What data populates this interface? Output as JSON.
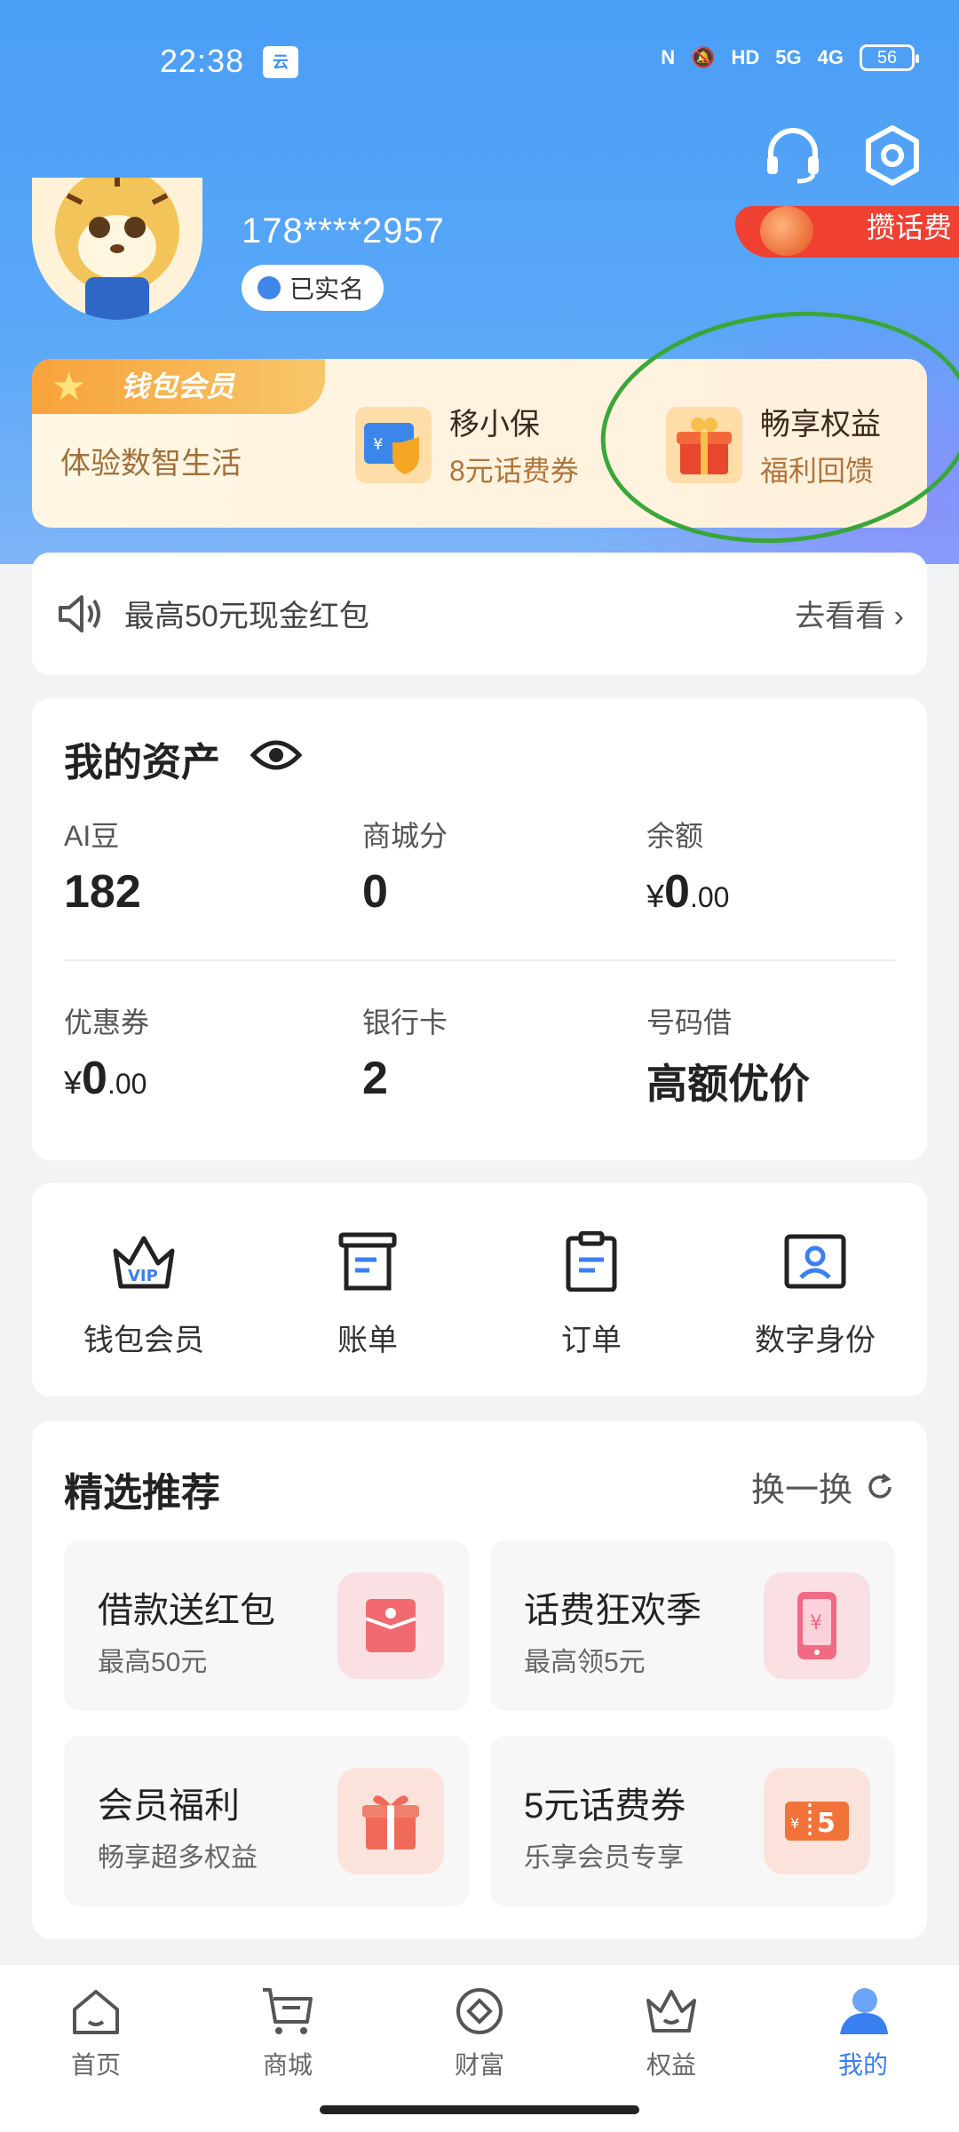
{
  "status_bar": {
    "time": "22:38",
    "app_badge": "云",
    "network_labels": [
      "HD",
      "5G",
      "4G"
    ],
    "battery": "56"
  },
  "header": {
    "icons": [
      "headset-icon",
      "settings-hexagon-icon"
    ]
  },
  "profile": {
    "phone": "178****2957",
    "verified_label": "已实名",
    "promo_corner": "攒话费"
  },
  "member_card": {
    "badge": "钱包会员",
    "subtitle": "体验数智生活",
    "items": [
      {
        "title": "移小保",
        "subtitle": "8元话费券"
      },
      {
        "title": "畅享权益",
        "subtitle": "福利回馈"
      }
    ]
  },
  "notice": {
    "text": "最高50元现金红包",
    "action": "去看看"
  },
  "assets": {
    "title": "我的资产",
    "row1": [
      {
        "label": "AI豆",
        "value": "182"
      },
      {
        "label": "商城分",
        "value": "0"
      },
      {
        "label": "余额",
        "currency": "¥",
        "int": "0",
        "dec": ".00"
      }
    ],
    "row2": [
      {
        "label": "优惠券",
        "currency": "¥",
        "int": "0",
        "dec": ".00"
      },
      {
        "label": "银行卡",
        "value": "2"
      },
      {
        "label": "号码借",
        "value": "高额优价"
      }
    ]
  },
  "quick_actions": [
    {
      "label": "钱包会员",
      "icon": "vip-crown-icon"
    },
    {
      "label": "账单",
      "icon": "bill-icon"
    },
    {
      "label": "订单",
      "icon": "order-clipboard-icon"
    },
    {
      "label": "数字身份",
      "icon": "id-card-icon"
    }
  ],
  "recommend": {
    "title": "精选推荐",
    "refresh": "换一换",
    "items": [
      {
        "title": "借款送红包",
        "subtitle": "最高50元",
        "icon": "red-envelope-icon"
      },
      {
        "title": "话费狂欢季",
        "subtitle": "最高领5元",
        "icon": "phone-yuan-icon"
      },
      {
        "title": "会员福利",
        "subtitle": "畅享超多权益",
        "icon": "gift-icon"
      },
      {
        "title": "5元话费券",
        "subtitle": "乐享会员专享",
        "icon": "coupon-5-icon"
      }
    ]
  },
  "bottom_nav": [
    {
      "label": "首页",
      "icon": "home-icon",
      "active": false
    },
    {
      "label": "商城",
      "icon": "cart-icon",
      "active": false
    },
    {
      "label": "财富",
      "icon": "wealth-icon",
      "active": false
    },
    {
      "label": "权益",
      "icon": "crown-icon",
      "active": false
    },
    {
      "label": "我的",
      "icon": "user-icon",
      "active": true
    }
  ],
  "colors": {
    "hero_blue": "#4a9ef6",
    "active_nav": "#3a7ff2",
    "member_gold": "#f8a23a",
    "annotation_green": "#3aa63a"
  }
}
